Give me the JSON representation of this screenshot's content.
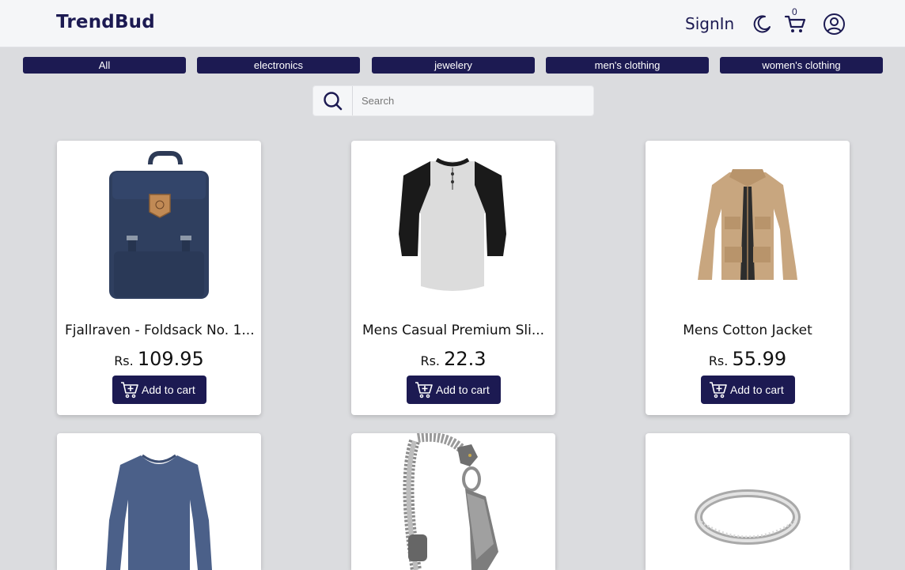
{
  "brand": "TrendBud",
  "nav": {
    "signin": "SignIn",
    "cart_count": "0",
    "icons": [
      "moon-icon",
      "cart-icon",
      "user-icon"
    ]
  },
  "categories": [
    "All",
    "electronics",
    "jewelery",
    "men's clothing",
    "women's clothing"
  ],
  "search": {
    "placeholder": "Search",
    "value": ""
  },
  "currency": "Rs.",
  "add_to_cart_label": "Add to cart",
  "products": [
    {
      "title": "Fjallraven - Foldsack No. 1...",
      "price": "109.95"
    },
    {
      "title": "Mens Casual Premium Sli...",
      "price": "22.3"
    },
    {
      "title": "Mens Cotton Jacket",
      "price": "55.99"
    },
    {
      "title": "",
      "price": ""
    },
    {
      "title": "",
      "price": ""
    },
    {
      "title": "",
      "price": ""
    }
  ],
  "colors": {
    "brand": "#1c1a52",
    "background": "#dbdcdf",
    "navbar": "#f5f6f8"
  }
}
